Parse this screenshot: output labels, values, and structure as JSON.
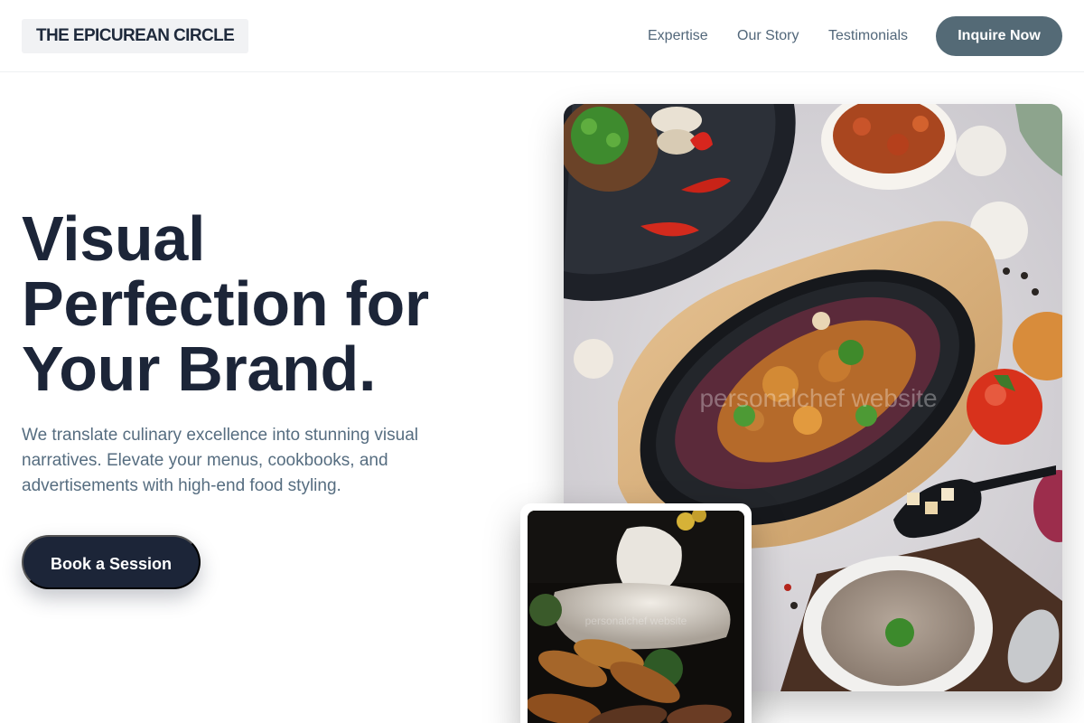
{
  "header": {
    "logo": "THE EPICUREAN CIRCLE",
    "nav": [
      "Expertise",
      "Our Story",
      "Testimonials"
    ],
    "cta": "Inquire Now"
  },
  "hero": {
    "headline_lines": [
      "Visual",
      "Perfection for",
      "Your Brand."
    ],
    "subtitle_lines": [
      "We translate culinary excellence into stunning visual",
      "narratives. Elevate your menus, cookbooks, and",
      "advertisements with high-end food styling."
    ],
    "cta": "Book a Session"
  },
  "images": {
    "main_watermark": "personalchef website",
    "secondary_watermark": "personalchef website"
  },
  "colors": {
    "primary_dark": "#1c2538",
    "nav_text": "#52677a",
    "inquire_bg": "#546a76",
    "logo_bg": "#f1f2f4"
  }
}
